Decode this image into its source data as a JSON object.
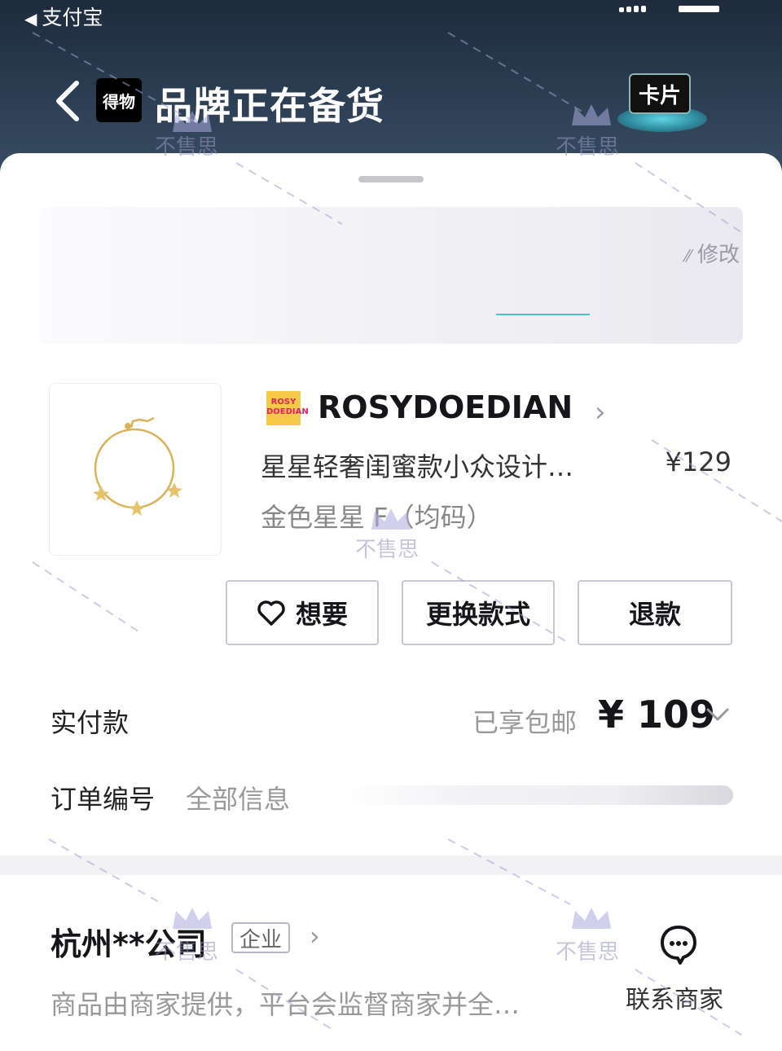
{
  "status_bar": {
    "back_app": "支付宝"
  },
  "header": {
    "title": "品牌正在备货",
    "app_logo_text": "得物",
    "card_label": "卡片"
  },
  "address": {
    "edit_label": "修改"
  },
  "product": {
    "brand_name": "ROSYDOEDIAN",
    "brand_logo_text": "ROSY DOEDIAN",
    "title": "星星轻奢闺蜜款小众设计…",
    "price": "¥129",
    "variant": "金色星星 F（均码）"
  },
  "actions": {
    "want": "想要",
    "exchange": "更换款式",
    "refund": "退款"
  },
  "payment": {
    "label": "实付款",
    "shipping_note": "已享包邮",
    "amount": "¥ 109"
  },
  "order": {
    "label": "订单编号",
    "info_link": "全部信息"
  },
  "merchant": {
    "name": "杭州**公司",
    "badge": "企业",
    "note": "商品由商家提供，平台会监督商家并全…",
    "contact_label": "联系商家"
  },
  "watermark": {
    "text": "不售思"
  },
  "colors": {
    "header_bg": "#2f4257",
    "accent_teal": "#43c6c4",
    "gold": "#f7c948"
  }
}
